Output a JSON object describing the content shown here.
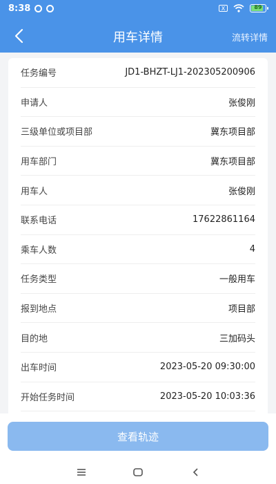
{
  "status_bar": {
    "time": "8:38",
    "sim_label": "X",
    "battery_level": "89"
  },
  "header": {
    "title": "用车详情",
    "right_link": "流转详情",
    "icons": [
      "back-chevron-icon"
    ]
  },
  "details": [
    {
      "label": "任务编号",
      "value": "JD1-BHZT-LJ1-202305200906"
    },
    {
      "label": "申请人",
      "value": "张俊刚"
    },
    {
      "label": "三级单位或项目部",
      "value": "冀东项目部"
    },
    {
      "label": "用车部门",
      "value": "冀东项目部"
    },
    {
      "label": "用车人",
      "value": "张俊刚"
    },
    {
      "label": "联系电话",
      "value": "17622861164"
    },
    {
      "label": "乘车人数",
      "value": "4"
    },
    {
      "label": "任务类型",
      "value": "一般用车"
    },
    {
      "label": "报到地点",
      "value": "项目部"
    },
    {
      "label": "目的地",
      "value": "三加码头"
    },
    {
      "label": "出车时间",
      "value": "2023-05-20 09:30:00"
    },
    {
      "label": "开始任务时间",
      "value": "2023-05-20 10:03:36"
    }
  ],
  "footer": {
    "button_label": "查看轨迹"
  },
  "colors": {
    "header_bg": "#4a93e8",
    "button_bg": "#8ab9ef"
  }
}
